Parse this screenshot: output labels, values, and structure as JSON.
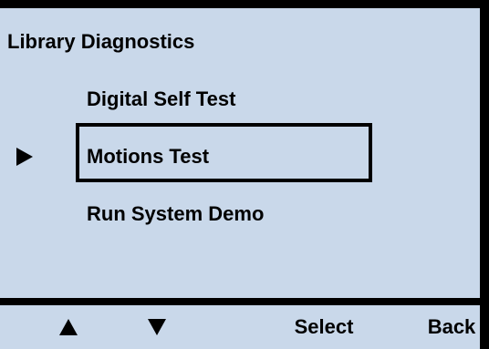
{
  "screen": {
    "title": "Library Diagnostics",
    "menu_items": [
      {
        "label": "Digital Self Test",
        "selected": false
      },
      {
        "label": "Motions Test",
        "selected": true
      },
      {
        "label": "Run System Demo",
        "selected": false
      }
    ]
  },
  "softkeys": {
    "up_icon": "up-triangle",
    "down_icon": "down-triangle",
    "select_label": "Select",
    "back_label": "Back"
  },
  "colors": {
    "background": "#c9d8ea",
    "foreground": "#000000"
  }
}
